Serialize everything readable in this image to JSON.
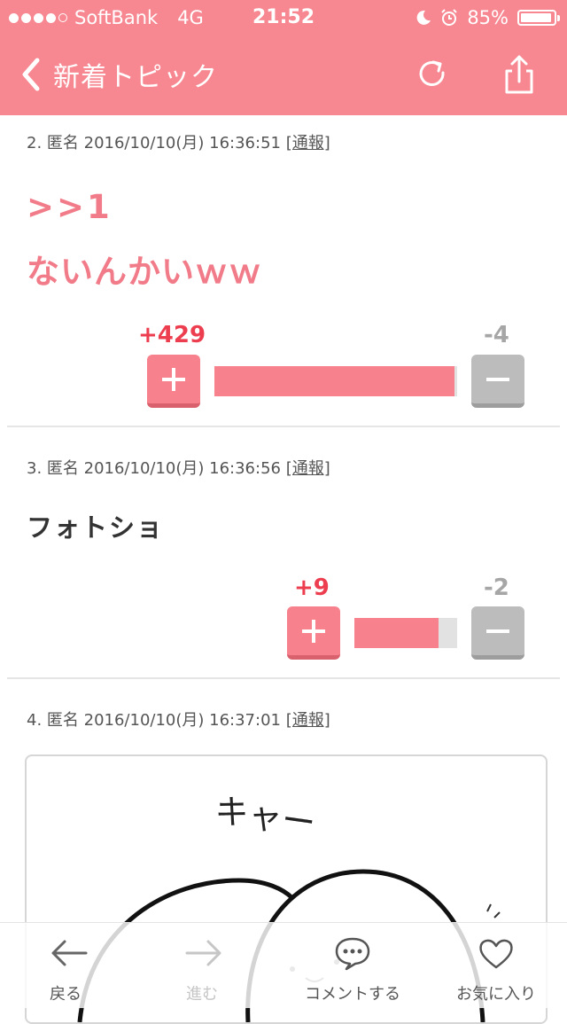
{
  "status_bar": {
    "carrier": "SoftBank",
    "network": "4G",
    "time": "21:52",
    "battery": "85%"
  },
  "nav": {
    "back_label": "新着トピック"
  },
  "posts": [
    {
      "meta": "2. 匿名 2016/10/10(月) 16:36:51 ",
      "report": "[通報]",
      "lines": [
        ">>1",
        "ないんかいｗｗ"
      ],
      "plus": "+429",
      "minus": "-4",
      "plus_ratio": 0.99
    },
    {
      "meta": "3. 匿名 2016/10/10(月) 16:36:56 ",
      "report": "[通報]",
      "lines": [
        "フォトショ"
      ],
      "plus": "+9",
      "minus": "-2",
      "plus_ratio": 0.82
    },
    {
      "meta": "4. 匿名 2016/10/10(月) 16:37:01 ",
      "report": "[通報]"
    }
  ],
  "image_text": "キャー",
  "toolbar": {
    "back": "戻る",
    "forward": "進む",
    "comment": "コメントする",
    "favorite": "お気に入り"
  },
  "colors": {
    "accent": "#f78791",
    "vote_plus": "#ec3e4f",
    "reply_text": "#f17b88"
  }
}
